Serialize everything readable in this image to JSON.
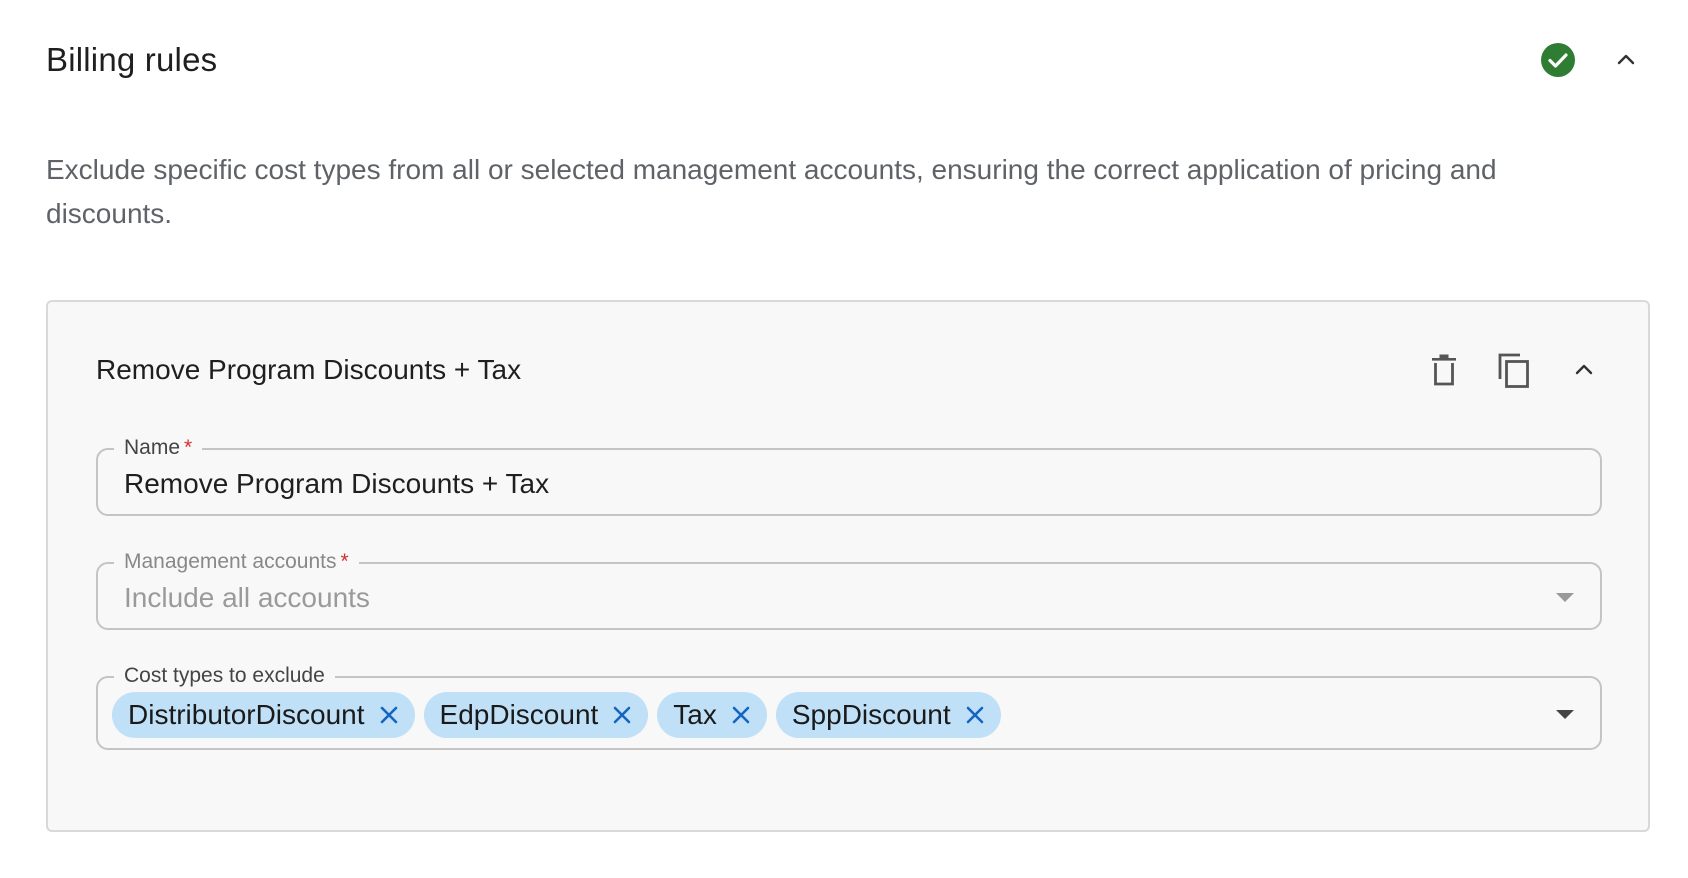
{
  "section": {
    "title": "Billing rules",
    "status_icon": "check-circle-icon",
    "status_color": "#2e7d32",
    "collapse_icon": "chevron-up-icon",
    "description": "Exclude specific cost types from all or selected management accounts, ensuring the correct application of pricing and discounts."
  },
  "rule": {
    "title": "Remove Program Discounts + Tax",
    "actions": {
      "delete_icon": "trash-icon",
      "duplicate_icon": "copy-icon",
      "collapse_icon": "chevron-up-icon"
    },
    "name_field": {
      "label": "Name",
      "required_marker": "*",
      "value": "Remove Program Discounts + Tax"
    },
    "accounts_field": {
      "label": "Management accounts",
      "required_marker": "*",
      "placeholder": "Include all accounts"
    },
    "cost_types_field": {
      "label": "Cost types to exclude",
      "chips": [
        {
          "label": "DistributorDiscount"
        },
        {
          "label": "EdpDiscount"
        },
        {
          "label": "Tax"
        },
        {
          "label": "SppDiscount"
        }
      ]
    }
  },
  "colors": {
    "chip_bg": "#bfe0f7",
    "chip_remove": "#1565c0",
    "required": "#d32f2f"
  }
}
